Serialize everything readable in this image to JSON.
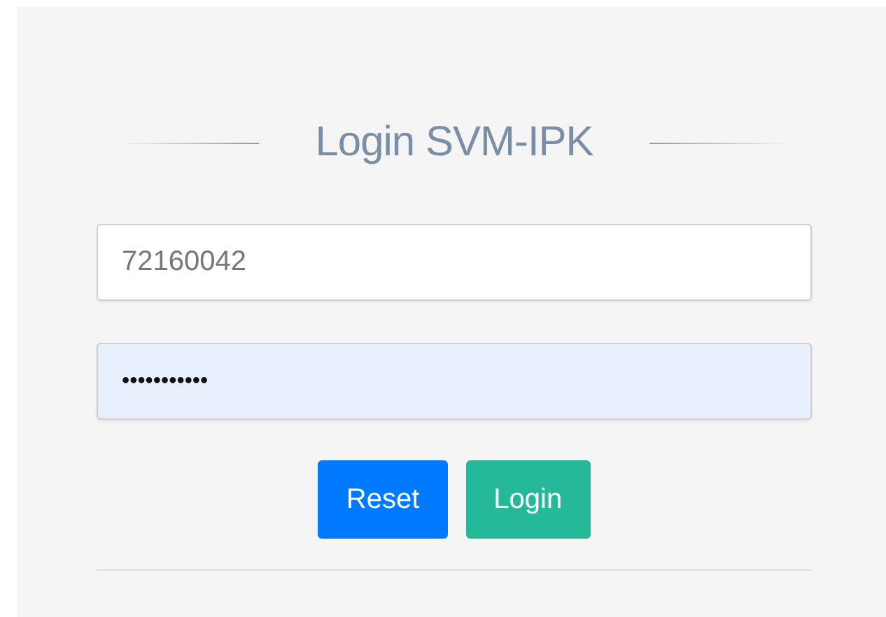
{
  "title": "Login SVM-IPK",
  "username": {
    "value": "72160042"
  },
  "password": {
    "value": "•••••••••••",
    "autofilled": true
  },
  "buttons": [
    {
      "label": "Reset",
      "kind": "reset"
    },
    {
      "label": "Login",
      "kind": "submit"
    }
  ]
}
